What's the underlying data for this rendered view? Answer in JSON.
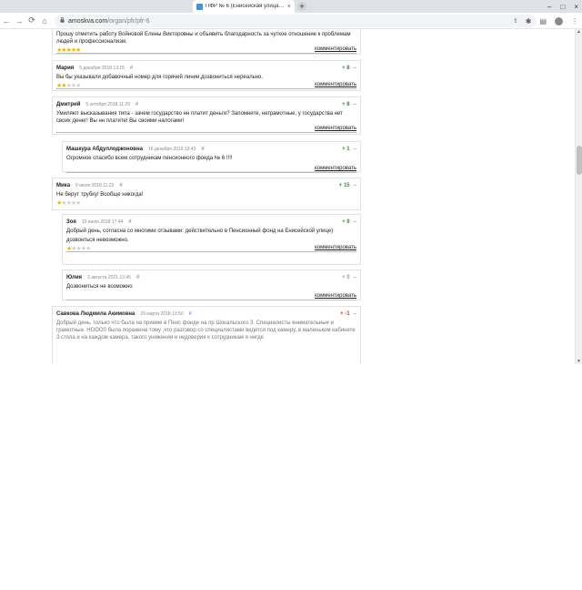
{
  "browser": {
    "tab_title": "ПФР № 6 (Енисейская улица, 2",
    "tab_close": "×",
    "new_tab": "+",
    "url_domain": "amoskva.com",
    "url_path": "/organ/pfr/pfr-6",
    "nav": {
      "back": "←",
      "forward": "→",
      "reload": "⟳",
      "home": "⌂"
    },
    "window": {
      "min": "–",
      "max": "□",
      "close": "×"
    }
  },
  "comments": [
    {
      "id": "c0",
      "author": "",
      "date": "",
      "text": "Прошу отметить работу Войновой Елены Викторовны и объявить благодарность за чуткое отношение к проблемам людей и профессионализм.",
      "rating": 5,
      "footer": "комментировать"
    },
    {
      "id": "c1",
      "author": "Мария",
      "date": "5 декабря 2018 13:15",
      "hash": "#",
      "score": "+ 8",
      "text": "Вы бы указывали добавочный номер для горячей линии,дозвониться нереально.",
      "rating": 2,
      "footer": "комментировать"
    },
    {
      "id": "c2",
      "author": "Дмитрий",
      "date": "5 октября 2018 11:29",
      "hash": "#",
      "score": "+ 8",
      "text": "Умиляют высказывания типа - зачем государство нн платит деньги? Запомните, неграмотные, у государства нет своих денег! Вы нн платите! Вы своими налогами!",
      "footer": "комментировать"
    },
    {
      "id": "c3",
      "author": "Машкура Абдуллоджоновна",
      "date": "16 декабря 2019 13:43",
      "hash": "#",
      "score": "+ 1",
      "text": "Огромное спасибо всем сотрудникам пенсионного фонда № 6 !!!!",
      "footer": "комментировать"
    },
    {
      "id": "c4",
      "author": "Мика",
      "date": "9 июля 2018 11:23",
      "hash": "#",
      "score": "+ 15",
      "text": "Не берут трубку! Вообще никогда!",
      "rating": 1,
      "footer": "комментировать"
    },
    {
      "id": "c5",
      "author": "Зоя",
      "date": "19 июля 2018 17:44",
      "hash": "#",
      "score": "+ 9",
      "text": "Добрый день, согласна со многими отзывами: действительно в Пенсионный фонд на Енисейской улице)",
      "text2": "дозвонться невозможно.",
      "rating": 1,
      "footer": "комментировать"
    },
    {
      "id": "c6",
      "author": "Юлия",
      "date": "3 августа 2021 13:45",
      "hash": "#",
      "score": "+ 0",
      "text": "Дозвониться не возможно",
      "footer": "комментировать"
    },
    {
      "id": "c7",
      "author": "Савкова Людмила Акимовна",
      "date": "29 марта 2018 13:50",
      "hash": "#",
      "score": "+ -1",
      "text": "Добрый день, только что была на приеме в Пенс фонде на пр Шокальского 3. Специалисты внимательные и грамотные. НООО0 была поражена тому ,что разговор со специалистами ведется под камеру, в маленьком кабинете 3 стола и на каждом камера, такого унижения и недоверия к сотрудникам я нигде"
    }
  ],
  "colors": {
    "accent": "#4a7db8",
    "plus": "#3a8a3a",
    "minus": "#cc3333",
    "star": "#f0b400"
  },
  "icons": {
    "star": "★",
    "lock": "🔒",
    "vote_minus": "–"
  }
}
